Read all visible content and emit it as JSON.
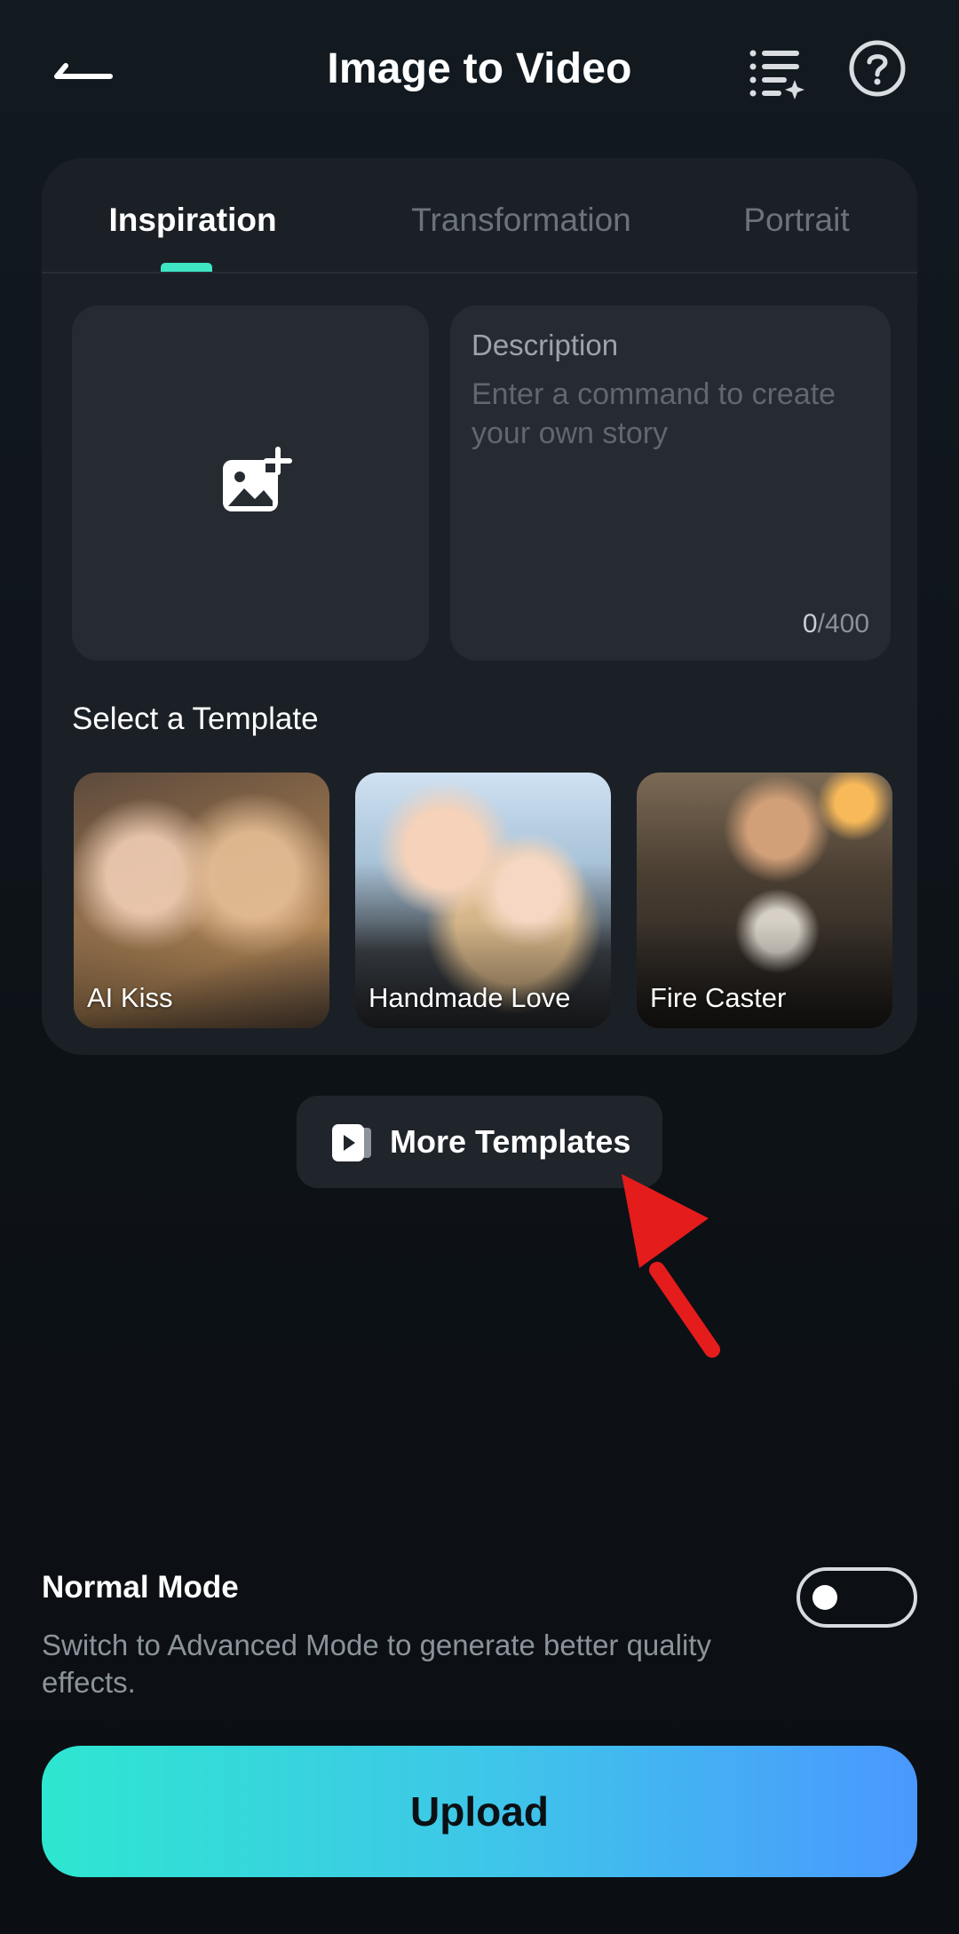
{
  "header": {
    "title": "Image to Video"
  },
  "tabs": [
    {
      "label": "Inspiration",
      "active": true
    },
    {
      "label": "Transformation",
      "active": false
    },
    {
      "label": "Portrait",
      "active": false
    }
  ],
  "description": {
    "label": "Description",
    "placeholder": "Enter a command to create your own story",
    "count": "0",
    "max": "/400"
  },
  "templates": {
    "section_label": "Select a Template",
    "items": [
      {
        "label": "AI Kiss"
      },
      {
        "label": "Handmade Love"
      },
      {
        "label": "Fire Caster"
      }
    ]
  },
  "more_templates": {
    "label": "More Templates"
  },
  "mode": {
    "title": "Normal Mode",
    "description": "Switch to Advanced Mode to generate better quality effects.",
    "toggle_on": false
  },
  "upload": {
    "label": "Upload"
  },
  "colors": {
    "accent": "#3ee6c5",
    "upload_gradient_start": "#2ee6d0",
    "upload_gradient_end": "#4a98ff",
    "annotation_arrow": "#e41c1c"
  },
  "icons": [
    "back-arrow-icon",
    "ai-list-icon",
    "help-icon",
    "add-image-icon",
    "video-template-icon"
  ]
}
